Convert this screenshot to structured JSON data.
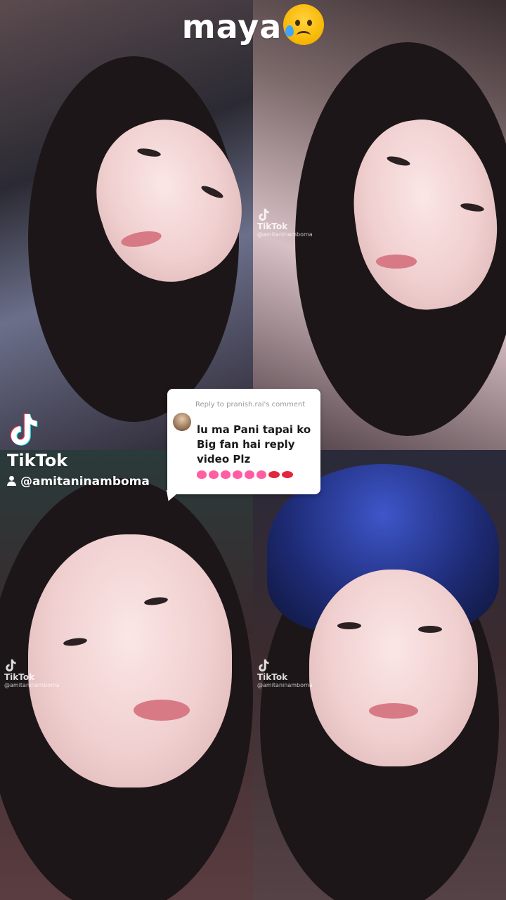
{
  "caption": {
    "text": "maya",
    "emoji_icon": "sad-sweat-face-emoji"
  },
  "comment": {
    "reply_to": "Reply to pranish.rai's comment",
    "text": "lu ma Pani tapai ko Big fan hai reply video Plz",
    "emoji": "💖💖💖💖💖💖💋💋"
  },
  "watermark": {
    "brand": "TikTok",
    "handle": "@amitaninamboma",
    "small_handle": "@amitaninamboma"
  },
  "colors": {
    "caption": "#ffffff",
    "comment_bg": "#ffffff",
    "heart": "#ff5fa2",
    "kiss": "#e4253a"
  }
}
